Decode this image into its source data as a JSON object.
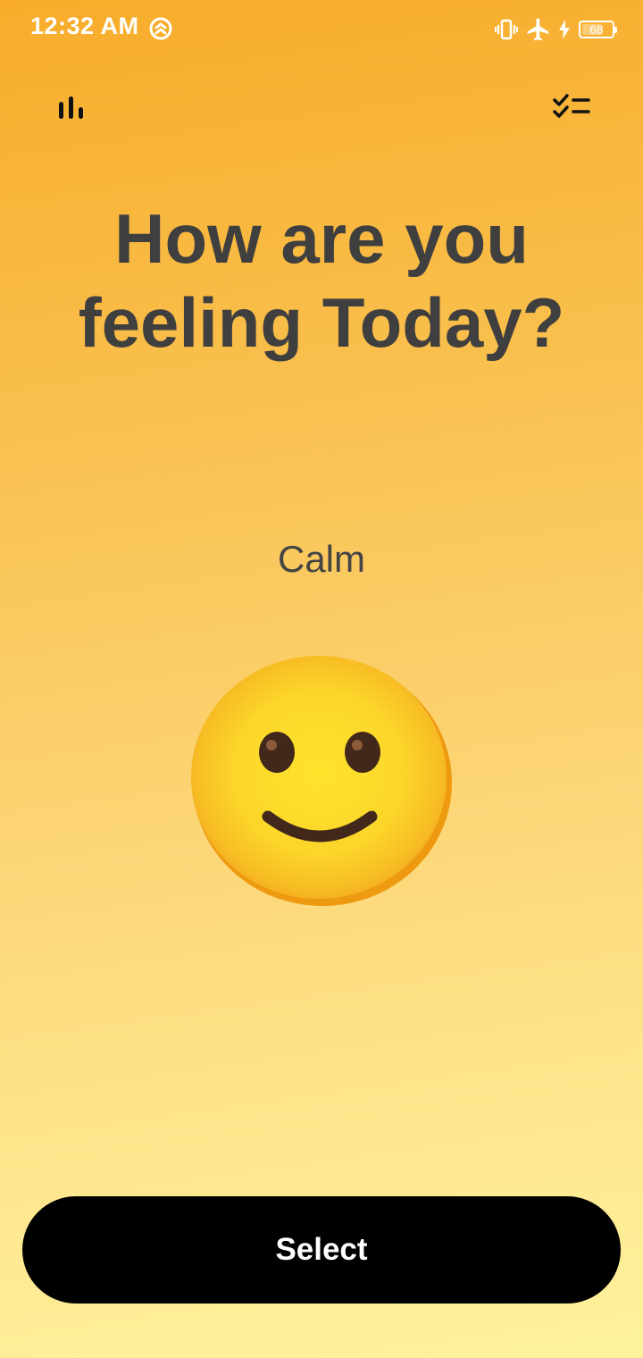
{
  "status_bar": {
    "time": "12:32 AM",
    "battery_level": "68",
    "battery_fraction": 0.68,
    "icons": [
      "sync-icon",
      "vibrate-icon",
      "airplane-icon",
      "charging-icon",
      "battery-icon"
    ]
  },
  "toolbar": {
    "left_icon": "bar-chart-icon",
    "right_icon": "checklist-icon"
  },
  "main": {
    "heading_line1": "How are you",
    "heading_line2": "feeling Today?",
    "mood_label": "Calm",
    "mood_emoji": "slightly-smiling-face"
  },
  "footer": {
    "select_label": "Select"
  },
  "colors": {
    "gradient_top": "#F8AC2A",
    "gradient_bottom": "#FEF39C",
    "heading": "#3F3F3F",
    "button_bg": "#000000",
    "button_text": "#FFFFFF"
  }
}
